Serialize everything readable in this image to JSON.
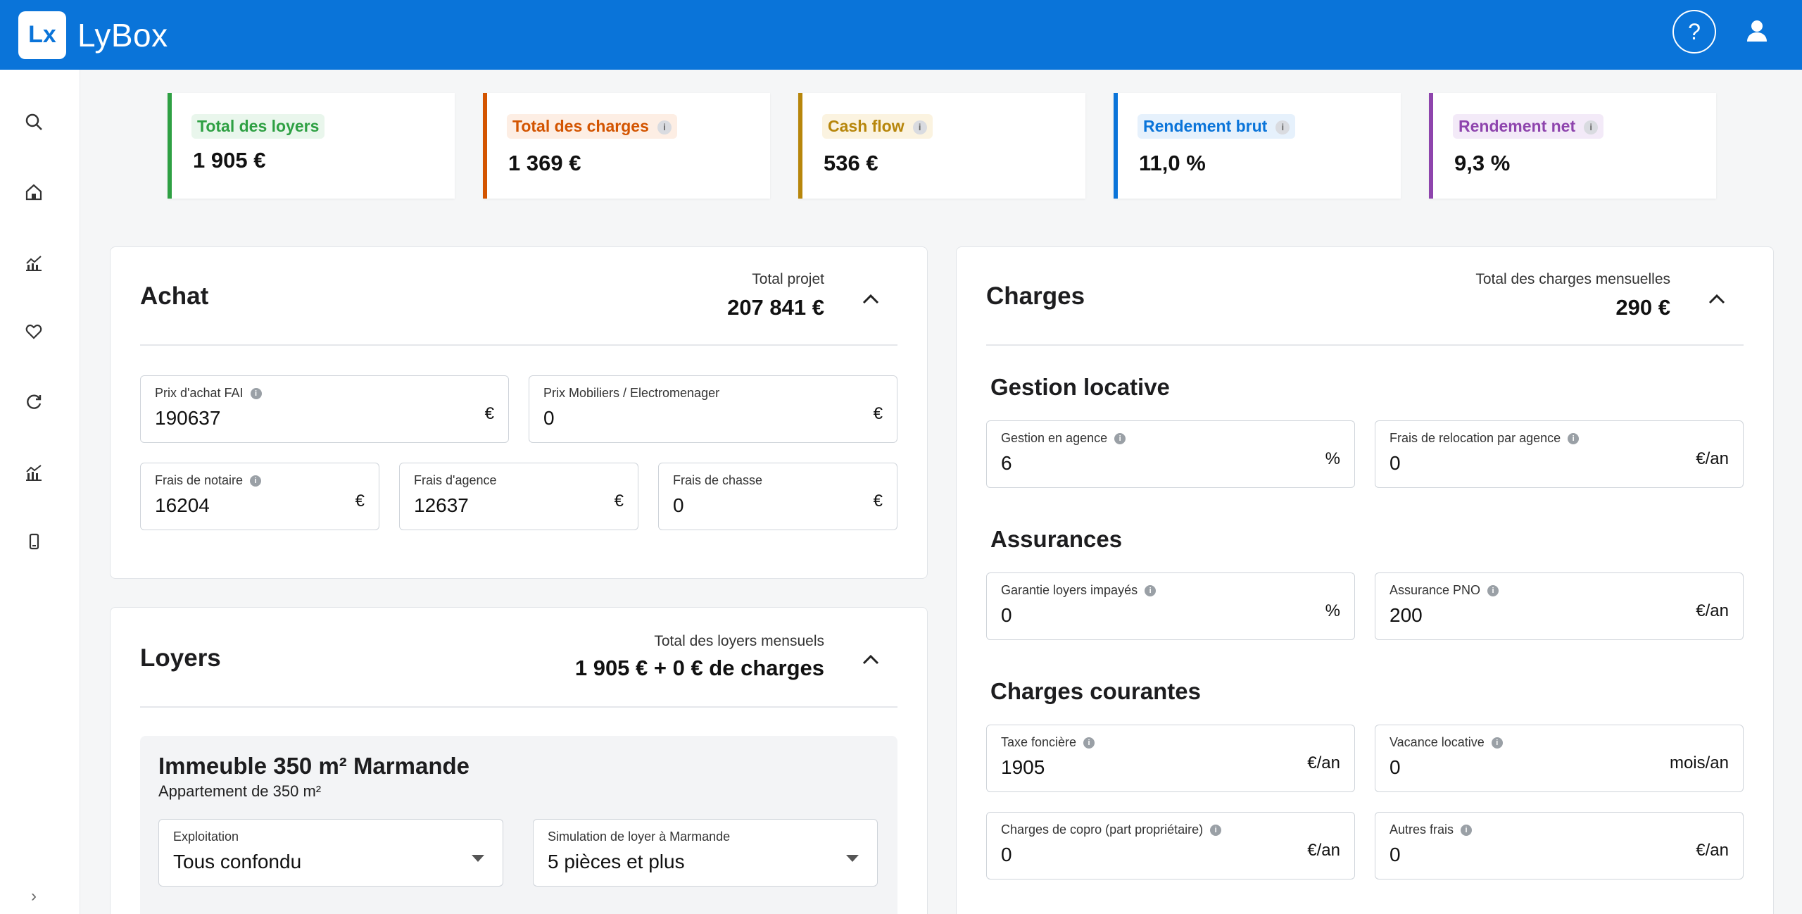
{
  "brand": {
    "logo_mark": "Lx",
    "name": "LyBox"
  },
  "header": {
    "help_label": "?"
  },
  "kpis": [
    {
      "label": "Total des loyers",
      "value": "1 905 €",
      "color": "#2ea043",
      "bg": "#e9f6ec",
      "info": false
    },
    {
      "label": "Total des charges",
      "value": "1 369 €",
      "color": "#d35400",
      "bg": "#fdeee4",
      "info": true
    },
    {
      "label": "Cash flow",
      "value": "536 €",
      "color": "#b7860b",
      "bg": "#fbf3e0",
      "info": true
    },
    {
      "label": "Rendement brut",
      "value": "11,0 %",
      "color": "#0a74d9",
      "bg": "#e6f1fc",
      "info": true
    },
    {
      "label": "Rendement net",
      "value": "9,3 %",
      "color": "#8e44ad",
      "bg": "#f3eaf8",
      "info": true
    }
  ],
  "achat": {
    "title": "Achat",
    "total_label": "Total projet",
    "total_value": "207 841 €",
    "fields": {
      "prix_achat": {
        "label": "Prix d'achat FAI",
        "value": "190637",
        "unit": "€"
      },
      "prix_mobiliers": {
        "label": "Prix Mobiliers / Electromenager",
        "value": "0",
        "unit": "€"
      },
      "frais_notaire": {
        "label": "Frais de notaire",
        "value": "16204",
        "unit": "€"
      },
      "frais_agence": {
        "label": "Frais d'agence",
        "value": "12637",
        "unit": "€"
      },
      "frais_chasse": {
        "label": "Frais de chasse",
        "value": "0",
        "unit": "€"
      }
    }
  },
  "loyers": {
    "title": "Loyers",
    "total_label": "Total des loyers mensuels",
    "total_value": "1 905 € + 0 € de charges",
    "property_title": "Immeuble 350 m² Marmande",
    "property_sub": "Appartement de 350 m²",
    "exploitation": {
      "label": "Exploitation",
      "value": "Tous confondu"
    },
    "simulation": {
      "label": "Simulation de loyer à Marmande",
      "value": "5 pièces et plus"
    }
  },
  "charges": {
    "title": "Charges",
    "total_label": "Total des charges mensuelles",
    "total_value": "290 €",
    "sections": {
      "gestion": "Gestion locative",
      "assurances": "Assurances",
      "courantes": "Charges courantes"
    },
    "fields": {
      "gestion_agence": {
        "label": "Gestion en agence",
        "value": "6",
        "unit": "%"
      },
      "frais_relocation": {
        "label": "Frais de relocation par agence",
        "value": "0",
        "unit": "€/an"
      },
      "garantie_loyers": {
        "label": "Garantie loyers impayés",
        "value": "0",
        "unit": "%"
      },
      "assurance_pno": {
        "label": "Assurance PNO",
        "value": "200",
        "unit": "€/an"
      },
      "taxe_fonciere": {
        "label": "Taxe foncière",
        "value": "1905",
        "unit": "€/an"
      },
      "vacance_locative": {
        "label": "Vacance locative",
        "value": "0",
        "unit": "mois/an"
      },
      "charges_copro": {
        "label": "Charges de copro (part propriétaire)",
        "value": "0",
        "unit": "€/an"
      },
      "autres_frais": {
        "label": "Autres frais",
        "value": "0",
        "unit": "€/an"
      }
    }
  },
  "sidebar": {
    "icons": [
      "search-icon",
      "home-icon",
      "chart-icon",
      "heart-icon",
      "refresh-icon",
      "analytics-icon",
      "mobile-icon"
    ],
    "expand_label": "›"
  }
}
